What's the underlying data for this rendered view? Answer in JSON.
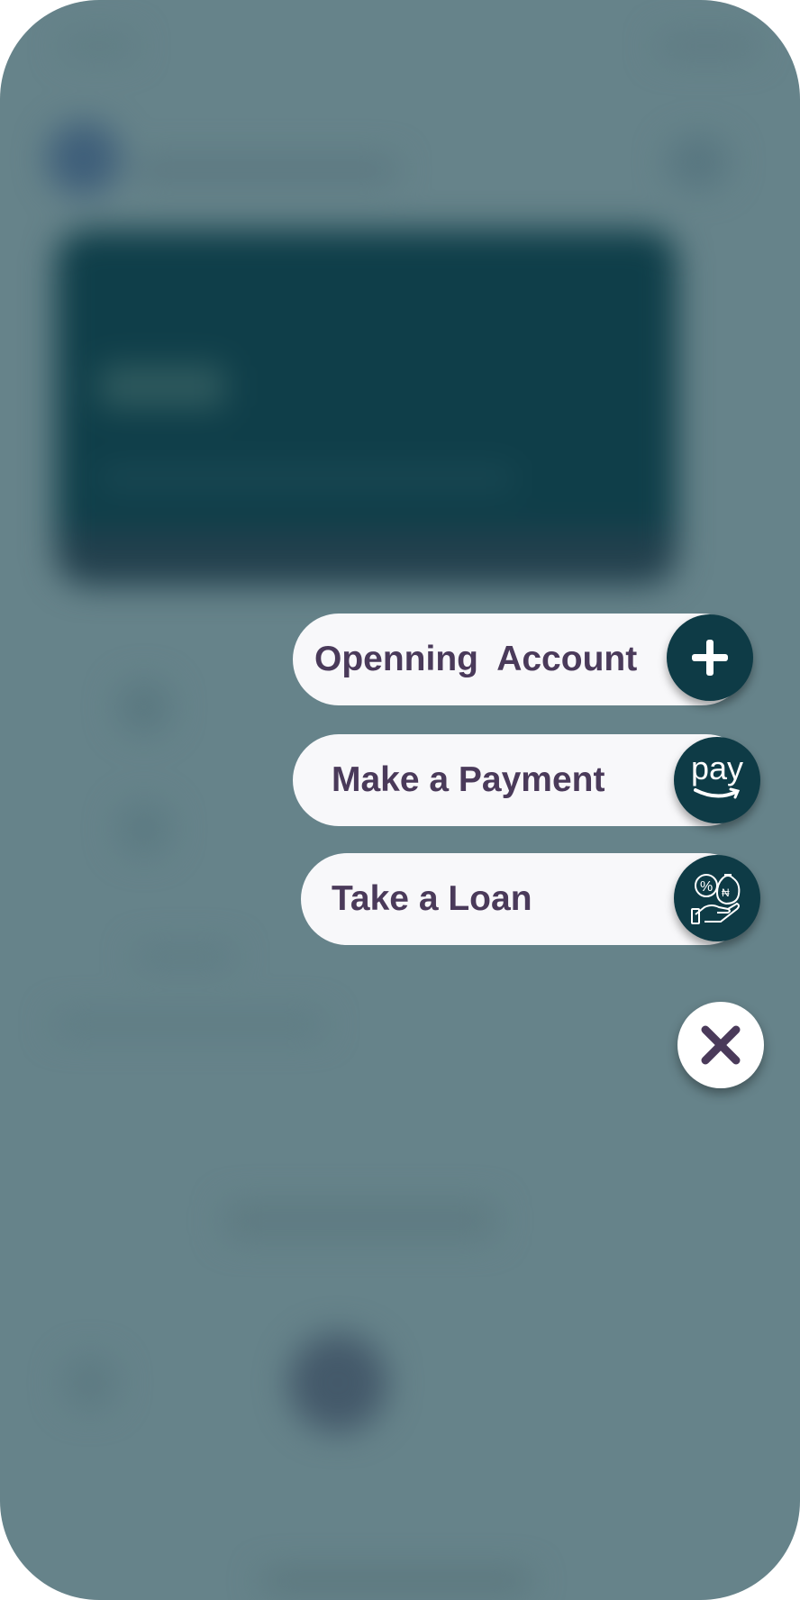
{
  "menu": {
    "items": [
      {
        "label": "Openning  Account",
        "icon": "plus-icon"
      },
      {
        "label": "Make a Payment",
        "icon": "pay-icon",
        "icon_text": "pay"
      },
      {
        "label": "Take a Loan",
        "icon": "loan-icon"
      }
    ],
    "close_icon": "close-icon"
  },
  "colors": {
    "overlay": "#66838a",
    "pill_bg": "#f8f8fa",
    "label_text": "#4a3a5a",
    "icon_bg": "#0e3b46",
    "close_bg": "#ffffff",
    "close_x": "#4a3a5a"
  }
}
